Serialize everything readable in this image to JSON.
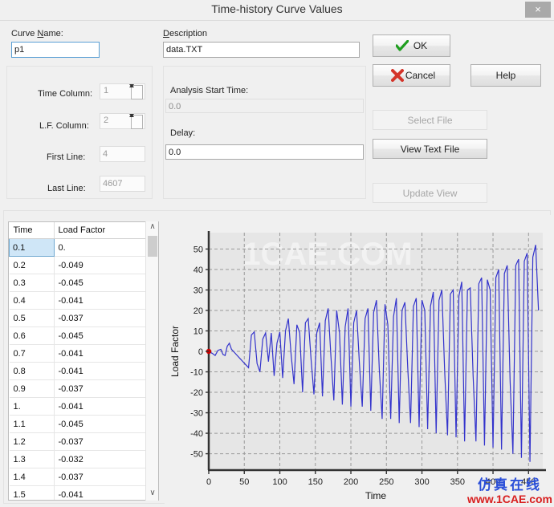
{
  "window": {
    "title": "Time-history Curve Values",
    "close_icon": "close-icon",
    "close_glyph": "×"
  },
  "form": {
    "curve_name": {
      "label_pre": "Curve ",
      "label_mnemonic": "N",
      "label_post": "ame:",
      "value": "p1",
      "placeholder": "Curve name"
    },
    "description": {
      "label_mnemonic": "D",
      "label_post": "escription",
      "value": "data.TXT",
      "placeholder": "Description"
    },
    "time_column": {
      "label": "Time Column:",
      "value": "1"
    },
    "lf_column": {
      "label": "L.F. Column:",
      "value": "2"
    },
    "first_line": {
      "label": "First Line:",
      "value": "4"
    },
    "last_line": {
      "label": "Last Line:",
      "value": "4607"
    },
    "analysis_start_time": {
      "label": "Analysis Start Time:",
      "value": "0.0"
    },
    "delay": {
      "label": "Delay:",
      "value": "0.0"
    }
  },
  "buttons": {
    "ok": {
      "label": "OK",
      "icon": "check-icon",
      "enabled": true
    },
    "cancel": {
      "label": "Cancel",
      "icon": "cross-icon",
      "enabled": true
    },
    "help": {
      "label": "Help",
      "enabled": true
    },
    "select_file": {
      "label": "Select File",
      "enabled": false
    },
    "view_text_file": {
      "label": "View Text File",
      "enabled": true
    },
    "update_view": {
      "label": "Update View",
      "enabled": false
    }
  },
  "table": {
    "columns": [
      "Time",
      "Load Factor"
    ],
    "selected_row": 0,
    "rows": [
      [
        "0.1",
        "0."
      ],
      [
        "0.2",
        "-0.049"
      ],
      [
        "0.3",
        "-0.045"
      ],
      [
        "0.4",
        "-0.041"
      ],
      [
        "0.5",
        "-0.037"
      ],
      [
        "0.6",
        "-0.045"
      ],
      [
        "0.7",
        "-0.041"
      ],
      [
        "0.8",
        "-0.041"
      ],
      [
        "0.9",
        "-0.037"
      ],
      [
        "1.",
        "-0.041"
      ],
      [
        "1.1",
        "-0.045"
      ],
      [
        "1.2",
        "-0.037"
      ],
      [
        "1.3",
        "-0.032"
      ],
      [
        "1.4",
        "-0.037"
      ],
      [
        "1.5",
        "-0.041"
      ]
    ],
    "scrollbar": {
      "up_glyph": "∧",
      "down_glyph": "∨"
    }
  },
  "chart_data": {
    "type": "line",
    "title": "",
    "xlabel": "Time",
    "ylabel": "Load Factor",
    "xlim": [
      0,
      470
    ],
    "ylim": [
      -58,
      58
    ],
    "xticks": [
      0,
      50,
      100,
      150,
      200,
      250,
      300,
      350,
      400,
      450
    ],
    "yticks": [
      -50,
      -40,
      -30,
      -20,
      -10,
      0,
      10,
      20,
      30,
      40,
      50
    ],
    "grid": true,
    "legend": "none",
    "line_color": "#3333cc",
    "marker": {
      "name": "start-point-marker",
      "color": "#cc0000",
      "x": 0,
      "y": 0
    },
    "watermark_plot": "1CAE.COM",
    "series": [
      {
        "name": "Load Factor",
        "x": [
          0,
          5,
          9,
          13,
          17,
          20,
          23,
          26,
          29,
          32,
          36,
          40,
          44,
          48,
          52,
          56,
          60,
          64,
          68,
          72,
          76,
          80,
          84,
          88,
          92,
          96,
          100,
          104,
          108,
          112,
          116,
          120,
          124,
          128,
          132,
          136,
          140,
          144,
          148,
          152,
          156,
          160,
          164,
          168,
          172,
          176,
          180,
          184,
          188,
          192,
          196,
          200,
          204,
          208,
          212,
          216,
          220,
          224,
          228,
          232,
          236,
          240,
          244,
          248,
          252,
          256,
          260,
          264,
          268,
          272,
          276,
          280,
          284,
          288,
          292,
          296,
          300,
          304,
          308,
          312,
          316,
          320,
          324,
          328,
          332,
          336,
          340,
          344,
          348,
          352,
          356,
          360,
          364,
          368,
          372,
          376,
          380,
          384,
          388,
          392,
          396,
          400,
          404,
          408,
          412,
          416,
          420,
          424,
          428,
          432,
          436,
          440,
          444,
          448,
          452,
          456,
          460,
          464
        ],
        "y": [
          0,
          -1,
          -2,
          0.5,
          1,
          -1.5,
          -2,
          2.5,
          4,
          1,
          -0.5,
          -2,
          -3.5,
          -5,
          -6.5,
          -8,
          8,
          9.5,
          -6,
          -10,
          6,
          9,
          -5,
          9,
          -12,
          4,
          9.5,
          -13,
          10,
          16,
          -2,
          -16,
          13,
          9,
          -20,
          14,
          16,
          -4,
          -21,
          9,
          14,
          -22,
          15,
          21,
          -3,
          -24,
          20,
          9,
          -26,
          12,
          21,
          -27,
          14,
          20,
          -6,
          -27,
          16,
          21,
          -29,
          19,
          25,
          -9,
          -33,
          23,
          13,
          -33,
          17,
          26,
          -35,
          20,
          24,
          -8,
          -35,
          22,
          26,
          -37,
          25,
          20,
          -38,
          22,
          29,
          -40,
          25,
          30,
          -10,
          -41,
          28,
          30,
          -42,
          27,
          34,
          -44,
          30,
          31,
          -12,
          -44,
          33,
          36,
          -46,
          35,
          30,
          -47,
          36,
          40,
          -48,
          38,
          42,
          -14,
          -50,
          42,
          45,
          -52,
          44,
          48,
          -54,
          46,
          52,
          20,
          -55,
          18
        ]
      }
    ]
  },
  "watermark": {
    "cn": "仿真在线",
    "url": "www.1CAE.com"
  }
}
